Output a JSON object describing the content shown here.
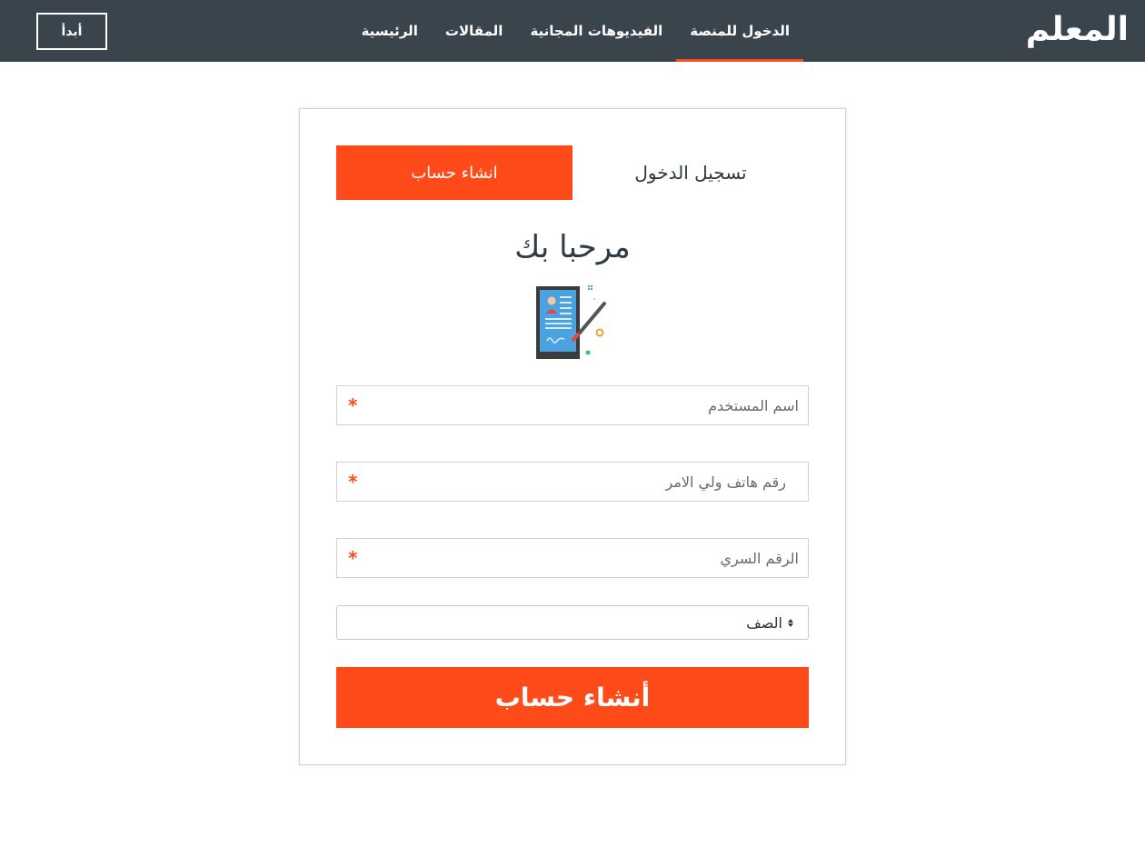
{
  "navbar": {
    "brand": "المعلم",
    "links": [
      {
        "label": "الرئيسية"
      },
      {
        "label": "المقالات"
      },
      {
        "label": "الفيديوهات المجانية"
      },
      {
        "label": "الدخول للمنصة"
      }
    ],
    "active_link": "الدخول للمنصة",
    "start_button": "أبدأ"
  },
  "auth": {
    "tabs": {
      "login": "تسجيل الدخول",
      "signup": "انشاء حساب"
    },
    "active_tab": "انشاء حساب",
    "welcome": "مرحبا بك",
    "illustration_icon": "registration-form-icon",
    "fields": {
      "username_placeholder": "اسم المستخدم",
      "phone_placeholder": "رقم هاتف ولي الامر",
      "password_placeholder": "الرقم السري",
      "required_mark": "*"
    },
    "grade_select": {
      "selected": "الصف"
    },
    "submit_label": "أنشاء حساب"
  },
  "colors": {
    "navbar_bg": "#3a444d",
    "accent": "#ff4b1a",
    "text_dark": "#2f3b45"
  }
}
